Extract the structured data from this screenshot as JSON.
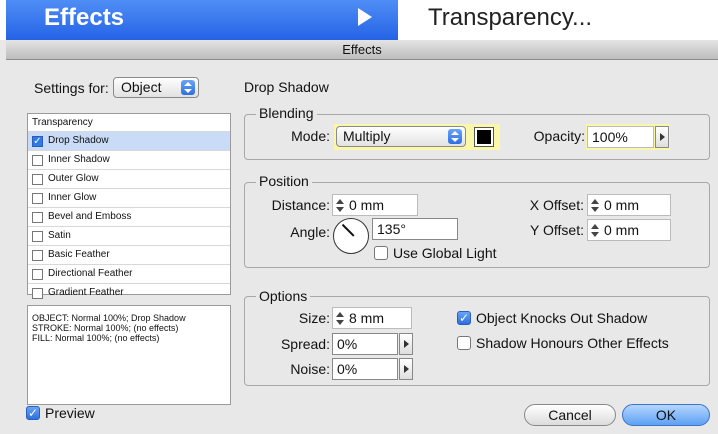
{
  "menu": {
    "effects_label": "Effects",
    "transparency_label": "Transparency..."
  },
  "window": {
    "title": "Effects"
  },
  "settings": {
    "label": "Settings for:",
    "selected": "Object"
  },
  "effects_list": {
    "header": "Transparency",
    "items": [
      {
        "label": "Drop Shadow",
        "checked": true,
        "selected": true
      },
      {
        "label": "Inner Shadow",
        "checked": false
      },
      {
        "label": "Outer Glow",
        "checked": false
      },
      {
        "label": "Inner Glow",
        "checked": false
      },
      {
        "label": "Bevel and Emboss",
        "checked": false
      },
      {
        "label": "Satin",
        "checked": false
      },
      {
        "label": "Basic Feather",
        "checked": false
      },
      {
        "label": "Directional Feather",
        "checked": false
      },
      {
        "label": "Gradient Feather",
        "checked": false
      }
    ]
  },
  "summary": {
    "line1": "OBJECT: Normal 100%; Drop Shadow",
    "line2": "STROKE: Normal 100%; (no effects)",
    "line3": "FILL: Normal 100%; (no effects)"
  },
  "panel": {
    "title": "Drop Shadow"
  },
  "blending": {
    "label": "Blending",
    "mode_label": "Mode:",
    "mode_value": "Multiply",
    "opacity_label": "Opacity:",
    "opacity_value": "100%",
    "swatch_color": "#000000"
  },
  "position": {
    "label": "Position",
    "distance_label": "Distance:",
    "distance_value": "0 mm",
    "angle_label": "Angle:",
    "angle_value": "135°",
    "use_global_light": "Use Global Light",
    "x_offset_label": "X Offset:",
    "x_offset_value": "0 mm",
    "y_offset_label": "Y Offset:",
    "y_offset_value": "0 mm"
  },
  "options": {
    "label": "Options",
    "size_label": "Size:",
    "size_value": "8 mm",
    "spread_label": "Spread:",
    "spread_value": "0%",
    "noise_label": "Noise:",
    "noise_value": "0%",
    "knocks_out_label": "Object Knocks Out Shadow",
    "honours_label": "Shadow Honours Other Effects"
  },
  "footer": {
    "preview_label": "Preview",
    "cancel_label": "Cancel",
    "ok_label": "OK"
  },
  "colors": {
    "accent": "#2563e6",
    "highlight": "#fbf7a8",
    "selection": "#c9dbf7"
  }
}
